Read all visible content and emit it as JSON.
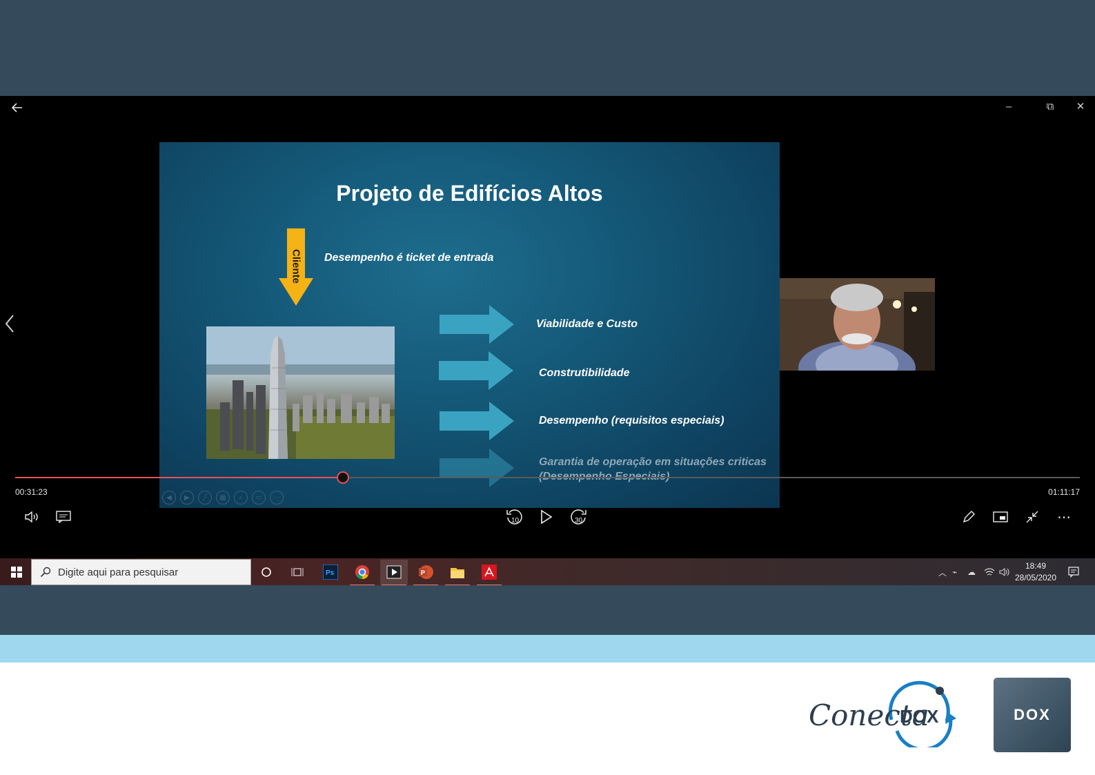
{
  "player": {
    "window_controls": {
      "minimize": "–",
      "restore": "⧉",
      "close": "✕"
    },
    "time_elapsed": "00:31:23",
    "time_total": "01:11:17",
    "progress_fraction": 0.31,
    "skip_back_label": "10",
    "skip_forward_label": "30"
  },
  "slide": {
    "title": "Projeto de Edifícios Altos",
    "cliente_label": "Cliente",
    "ticket_text": "Desempenho é ticket de entrada",
    "bullets": [
      "Viabilidade e Custo",
      "Construtibilidade",
      "Desempenho (requisitos especiais)",
      "Garantia de operação em situações criticas",
      "(Desempenho Especiais)"
    ]
  },
  "taskbar": {
    "search_placeholder": "Digite aqui para pesquisar",
    "clock_time": "18:49",
    "clock_date": "28/05/2020",
    "apps": [
      "cortana-icon",
      "task-view-icon",
      "photoshop-icon",
      "chrome-icon",
      "video-player-icon",
      "powerpoint-icon",
      "file-explorer-icon",
      "acrobat-icon"
    ]
  },
  "branding": {
    "conecta_text": "Conecta",
    "conecta_dox_text": "DOX",
    "dox_logo_text": "DOX"
  },
  "colors": {
    "top_band": "#354a5b",
    "light_band": "#9fd7ee",
    "progress": "#e9505a",
    "arrow_cyan": "#3aa3c1",
    "arrow_yellow": "#f5b214"
  }
}
